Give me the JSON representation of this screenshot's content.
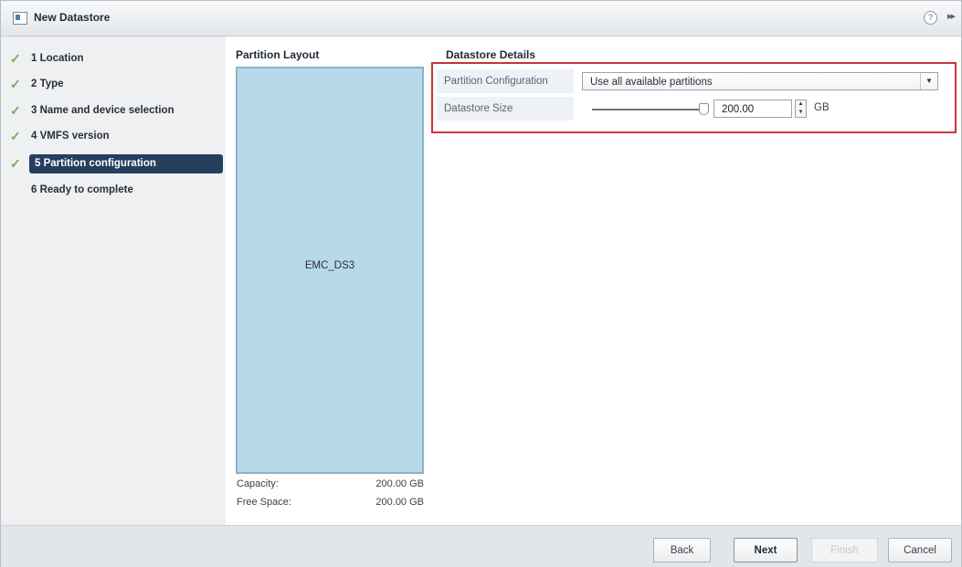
{
  "window": {
    "title": "New Datastore",
    "help": "?",
    "expand": "▸▸"
  },
  "steps": [
    {
      "label": "1 Location",
      "done": true
    },
    {
      "label": "2 Type",
      "done": true
    },
    {
      "label": "3 Name and device selection",
      "done": true
    },
    {
      "label": "4 VMFS version",
      "done": true
    },
    {
      "label": "5 Partition configuration",
      "done": true,
      "active": true
    },
    {
      "label": "6 Ready to complete",
      "done": false
    }
  ],
  "partition_layout": {
    "title": "Partition Layout",
    "partition_name": "EMC_DS3",
    "capacity_label": "Capacity:",
    "capacity_value": "200.00 GB",
    "free_label": "Free Space:",
    "free_value": "200.00 GB"
  },
  "details": {
    "title": "Datastore Details",
    "partition_config_label": "Partition Configuration",
    "partition_config_value": "Use all available partitions",
    "size_label": "Datastore Size",
    "size_value": "200.00",
    "size_unit": "GB",
    "size_slider_fraction": 1.0
  },
  "footer": {
    "back": "Back",
    "next": "Next",
    "finish": "Finish",
    "cancel": "Cancel"
  },
  "colors": {
    "active_step_bg": "#253f5e",
    "check": "#6bb24d",
    "partition_fill": "#b7d9ea",
    "highlight_border": "#cc3333"
  }
}
